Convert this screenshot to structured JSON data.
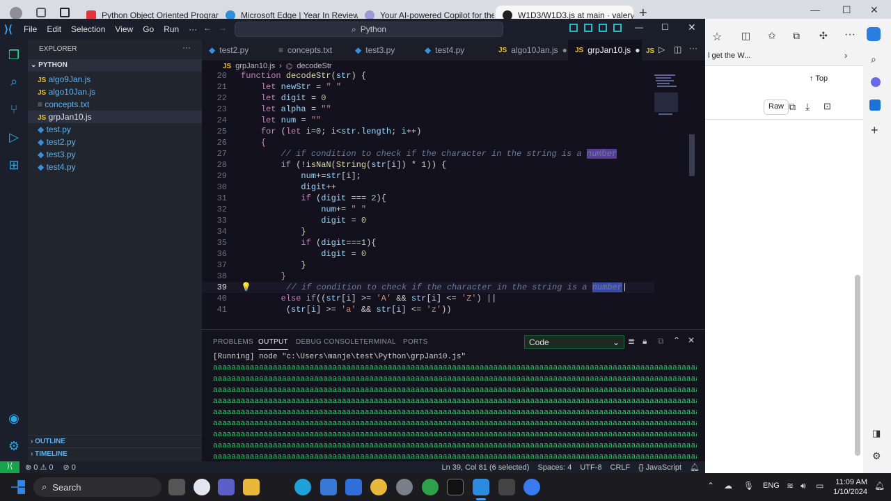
{
  "browser": {
    "tabs": [
      {
        "title": "Python Object Oriented Program",
        "color": "#e3333c"
      },
      {
        "title": "Microsoft Edge | Year In Review",
        "color": "#2f8fd8"
      },
      {
        "title": "Your AI-powered Copilot for the",
        "color": "#9b9bd8"
      },
      {
        "title": "W1D3/W1D3.js at main · valerylo",
        "color": "#222222"
      }
    ],
    "new_tab": "+",
    "side_text": "l get the W...",
    "top_label": "Top",
    "raw_label": "Raw"
  },
  "vscode": {
    "menu": [
      "File",
      "Edit",
      "Selection",
      "View",
      "Go",
      "Run",
      "···"
    ],
    "command_center": "Python",
    "explorer": {
      "title": "EXPLORER",
      "folder": "PYTHON",
      "files": [
        "algo9Jan.js",
        "algo10Jan.js",
        "concepts.txt",
        "grpJan10.js",
        "test.py",
        "test2.py",
        "test3.py",
        "test4.py"
      ],
      "outline": "OUTLINE",
      "timeline": "TIMELINE"
    },
    "tabs": [
      {
        "name": "test2.py",
        "type": "py"
      },
      {
        "name": "concepts.txt",
        "type": "txt"
      },
      {
        "name": "test3.py",
        "type": "py"
      },
      {
        "name": "test4.py",
        "type": "py"
      },
      {
        "name": "algo10Jan.js",
        "type": "js"
      },
      {
        "name": "grpJan10.js",
        "type": "js"
      }
    ],
    "breadcrumb": {
      "file": "grpJan10.js",
      "symbol": "decodeStr"
    },
    "code": [
      {
        "n": "20",
        "t": "function decodeStr(str) {"
      },
      {
        "n": "21",
        "t": "    let newStr = \" \""
      },
      {
        "n": "22",
        "t": "    let digit = 0"
      },
      {
        "n": "23",
        "t": "    let alpha = \"\""
      },
      {
        "n": "24",
        "t": "    let num = \"\""
      },
      {
        "n": "25",
        "t": "    for (let i=0; i<str.length; i++)"
      },
      {
        "n": "26",
        "t": "    {"
      },
      {
        "n": "27",
        "t": "        // if condition to check if the character in the string is a number"
      },
      {
        "n": "28",
        "t": "        if (!isNaN(String(str[i]) * 1)) {"
      },
      {
        "n": "29",
        "t": "            num+=str[i];"
      },
      {
        "n": "30",
        "t": "            digit++"
      },
      {
        "n": "31",
        "t": "            if (digit === 2){"
      },
      {
        "n": "32",
        "t": "                num+= \" \""
      },
      {
        "n": "33",
        "t": "                digit = 0"
      },
      {
        "n": "34",
        "t": "            }"
      },
      {
        "n": "35",
        "t": "            if (digit===1){"
      },
      {
        "n": "36",
        "t": "                digit = 0"
      },
      {
        "n": "37",
        "t": "            }"
      },
      {
        "n": "38",
        "t": "        }"
      },
      {
        "n": "39",
        "t": "         // if condition to check if the character in the string is a number"
      },
      {
        "n": "40",
        "t": "        else if((str[i] >= 'A' && str[i] <= 'Z') ||"
      },
      {
        "n": "41",
        "t": "         (str[i] >= 'a' && str[i] <= 'z'))"
      }
    ],
    "panel": {
      "tabs": [
        "PROBLEMS",
        "OUTPUT",
        "DEBUG CONSOLE",
        "TERMINAL",
        "PORTS"
      ],
      "active_tab": "OUTPUT",
      "select": "Code",
      "running": "[Running] node \"c:\\Users\\manje\\test\\Python\\grpJan10.js\"",
      "output_line": "aaaaaaaaaaaaaaaaaaaaaaaaaaaaaaaaaaaaaaaaaaaaaaaaaaaaaaaaaaaaaaaaaaaaaaaaaaaaaaaaaaaaaaaaaaaaaaaaaaaaaaaaaaaaaaaaaaaaaaaa"
    },
    "status": {
      "errors": "0",
      "warnings": "0",
      "ports": "0",
      "position": "Ln 39, Col 81 (6 selected)",
      "spaces": "Spaces: 4",
      "encoding": "UTF-8",
      "eol": "CRLF",
      "language": "JavaScript"
    }
  },
  "taskbar": {
    "search": "Search",
    "lang": "ENG",
    "time": "11:09 AM",
    "date": "1/10/2024"
  }
}
